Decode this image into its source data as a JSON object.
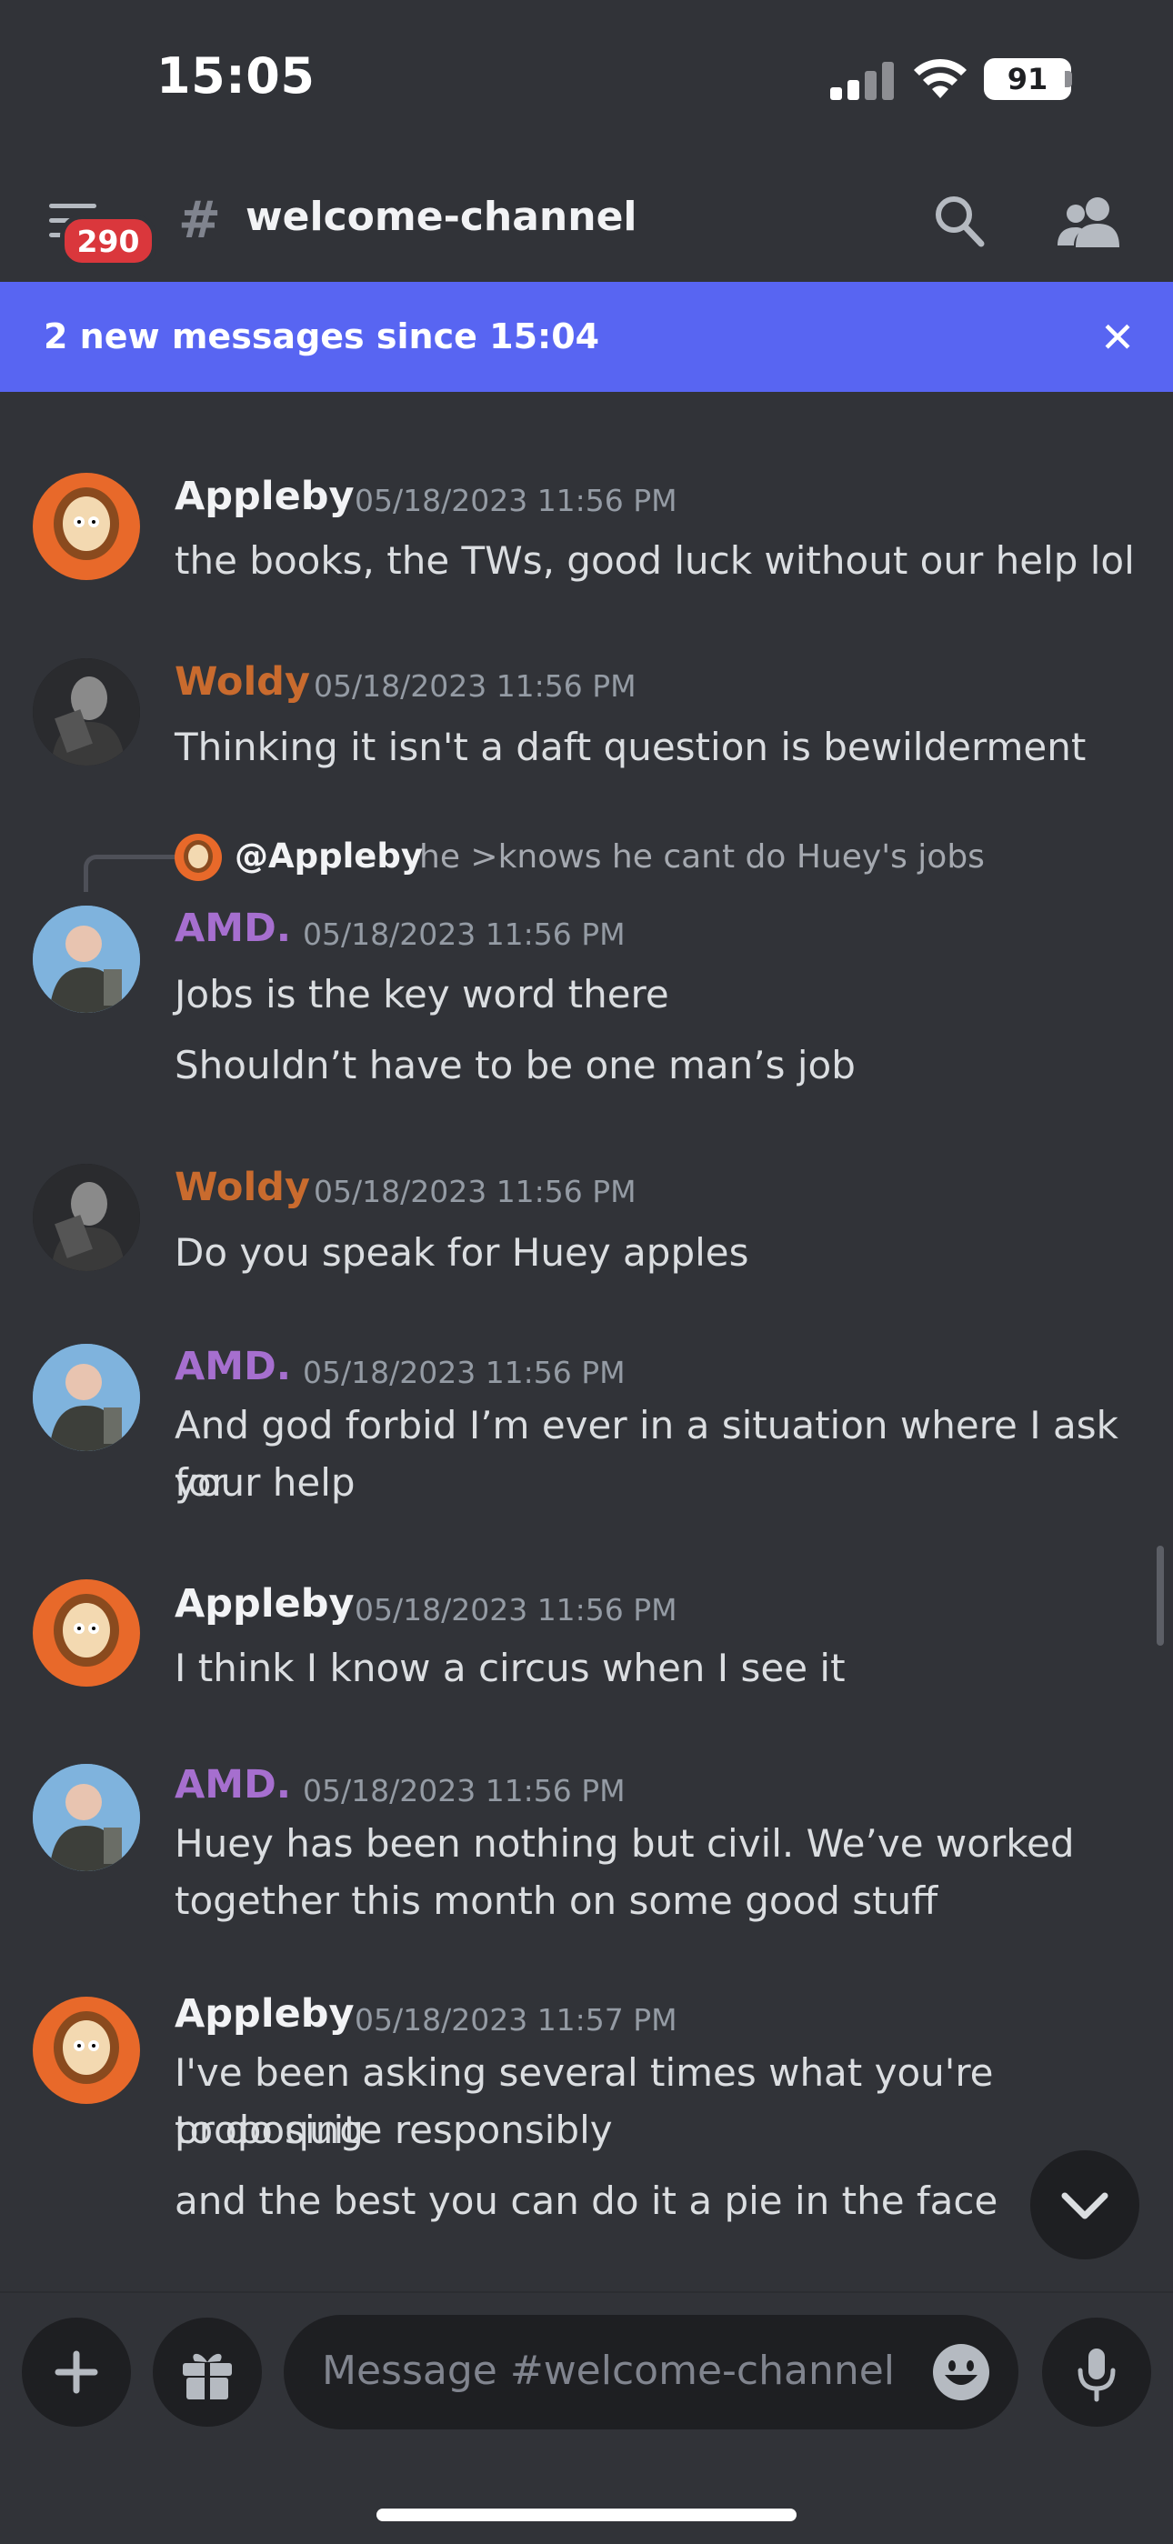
{
  "status_bar": {
    "time": "15:05",
    "battery": "91"
  },
  "header": {
    "notification_count": "290",
    "channel_hash": "#",
    "channel_name": "welcome-channel"
  },
  "new_messages_bar": {
    "text": "2 new messages since 15:04"
  },
  "messages": [
    {
      "author": "Appleby",
      "color": "#f2f3f5",
      "timestamp": "05/18/2023 11:56 PM",
      "lines": [
        "the books, the TWs, good luck without our help lol"
      ]
    },
    {
      "author": "Woldy",
      "color": "#c96b2e",
      "timestamp": "05/18/2023 11:56 PM",
      "lines": [
        "Thinking it isn't a daft question is bewilderment"
      ]
    },
    {
      "author": "AMD.",
      "color": "#a66fcf",
      "timestamp": "05/18/2023 11:56 PM",
      "reply": {
        "author": "@Appleby",
        "text": "he >knows he cant do Huey's jobs"
      },
      "lines": [
        "Jobs is the key word there",
        "Shouldn’t have to be one man’s job"
      ]
    },
    {
      "author": "Woldy",
      "color": "#c96b2e",
      "timestamp": "05/18/2023 11:56 PM",
      "lines": [
        "Do you speak for Huey apples"
      ]
    },
    {
      "author": "AMD.",
      "color": "#a66fcf",
      "timestamp": "05/18/2023 11:56 PM",
      "lines": [
        "And god forbid I’m ever in a situation where I ask for",
        "your help"
      ]
    },
    {
      "author": "Appleby",
      "color": "#f2f3f5",
      "timestamp": "05/18/2023 11:56 PM",
      "lines": [
        "I think I know a circus when I see it"
      ]
    },
    {
      "author": "AMD.",
      "color": "#a66fcf",
      "timestamp": "05/18/2023 11:56 PM",
      "lines": [
        "Huey has been nothing but civil. We’ve worked",
        "together this month on some good stuff"
      ]
    },
    {
      "author": "Appleby",
      "color": "#f2f3f5",
      "timestamp": "05/18/2023 11:57 PM",
      "lines": [
        "I've been asking several times what you're proposing",
        "to do quite responsibly",
        "and the best you can do it a pie in the face"
      ]
    }
  ],
  "composer": {
    "placeholder": "Message #welcome-channel"
  },
  "icons": {
    "hamburger": "menu-icon",
    "search": "search-icon",
    "members": "members-icon",
    "close": "close-icon",
    "jump": "chevron-down-icon",
    "add": "plus-icon",
    "gift": "gift-icon",
    "emoji": "emoji-icon",
    "mic": "microphone-icon"
  },
  "colors": {
    "accent": "#5865f2",
    "background": "#313338",
    "badge": "#da373c"
  }
}
